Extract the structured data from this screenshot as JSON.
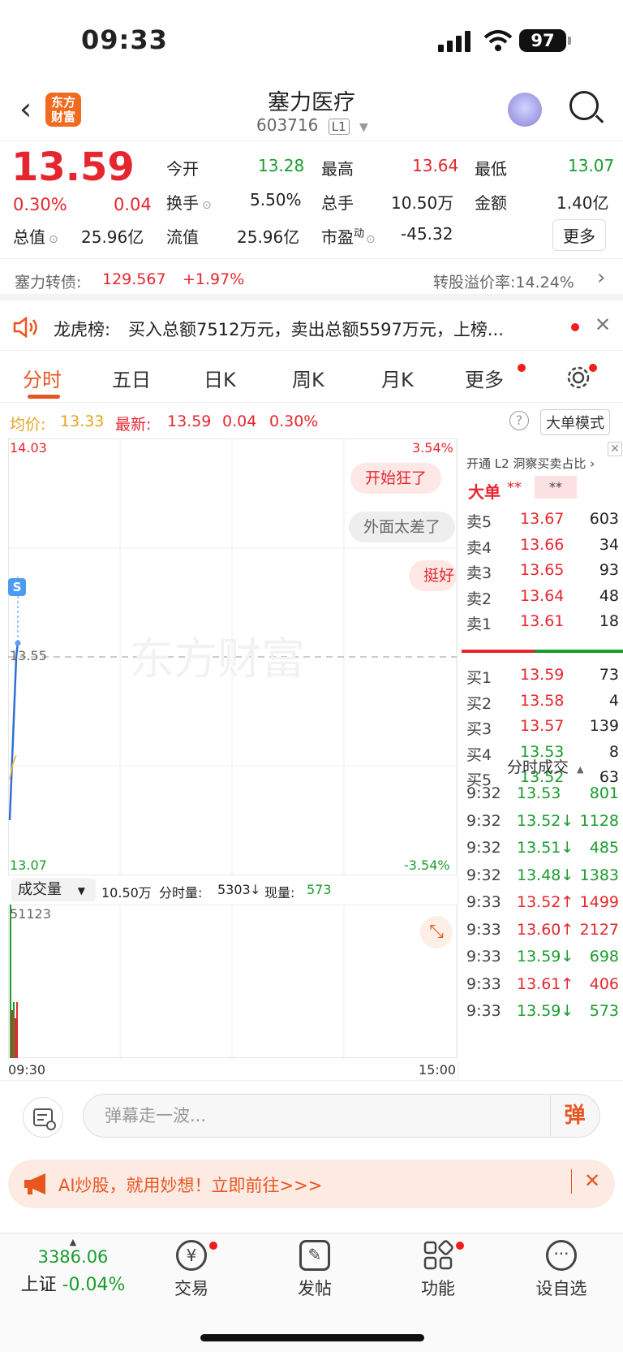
{
  "status": {
    "time": "09:33",
    "battery": "97"
  },
  "header": {
    "name": "塞力医疗",
    "code": "603716",
    "level": "L1",
    "logo": "东方\n财富"
  },
  "quote": {
    "price": "13.59",
    "pct": "0.30%",
    "change": "0.04",
    "open_label": "今开",
    "open": "13.28",
    "high_label": "最高",
    "high": "13.64",
    "low_label": "最低",
    "low": "13.07",
    "turnover_label": "换手",
    "turnover": "5.50%",
    "vol_label": "总手",
    "vol": "10.50万",
    "amt_label": "金额",
    "amt": "1.40亿",
    "mcap_label": "总值",
    "mcap": "25.96亿",
    "float_label": "流值",
    "float": "25.96亿",
    "pe_label": "市盈",
    "pe_sup": "动",
    "pe": "-45.32",
    "more": "更多"
  },
  "bond": {
    "label": "塞力转债:",
    "price": "129.567",
    "pct": "+1.97%",
    "premium": "转股溢价率:14.24%"
  },
  "dragon": {
    "label": "龙虎榜:",
    "text": "买入总额7512万元，卖出总额5597万元，上榜..."
  },
  "tabs": [
    "分时",
    "五日",
    "日K",
    "周K",
    "月K",
    "更多"
  ],
  "avg": {
    "avg_label": "均价:",
    "avg": "13.33",
    "latest_label": "最新:",
    "latest": "13.59",
    "chg": "0.04",
    "pct": "0.30%",
    "big_mode": "大单模式"
  },
  "chart": {
    "top_price": "14.03",
    "top_pct": "3.54%",
    "mid_price": "13.55",
    "bottom_price": "13.07",
    "bottom_pct": "-3.54%",
    "time_start": "09:30",
    "time_end": "15:00",
    "watermark": "东方财富",
    "s_marker": "S",
    "danmu": [
      "开始狂了",
      "外面太差了",
      "挺好"
    ]
  },
  "volume": {
    "selector": "成交量",
    "total": "10.50万",
    "fen_label": "分时量:",
    "fen": "5303",
    "now_label": "现量:",
    "now": "573",
    "max": "51123"
  },
  "book": {
    "l2": "开通 L2 洞察买卖占比",
    "big": "大单",
    "stars1": "**",
    "stars2": "**",
    "asks": [
      {
        "label": "卖5",
        "price": "13.67",
        "vol": "603"
      },
      {
        "label": "卖4",
        "price": "13.66",
        "vol": "34"
      },
      {
        "label": "卖3",
        "price": "13.65",
        "vol": "93"
      },
      {
        "label": "卖2",
        "price": "13.64",
        "vol": "48"
      },
      {
        "label": "卖1",
        "price": "13.61",
        "vol": "18"
      }
    ],
    "bids": [
      {
        "label": "买1",
        "price": "13.59",
        "vol": "73"
      },
      {
        "label": "买2",
        "price": "13.58",
        "vol": "4"
      },
      {
        "label": "买3",
        "price": "13.57",
        "vol": "139"
      },
      {
        "label": "买4",
        "price": "13.53",
        "vol": "8"
      },
      {
        "label": "买5",
        "price": "13.52",
        "vol": "63"
      }
    ],
    "ticks_title": "分时成交",
    "ticks": [
      {
        "time": "9:32",
        "price": "13.53",
        "dir": "",
        "vol": "801",
        "color": "green"
      },
      {
        "time": "9:32",
        "price": "13.52↓",
        "dir": "down",
        "vol": "1128",
        "color": "green"
      },
      {
        "time": "9:32",
        "price": "13.51↓",
        "dir": "down",
        "vol": "485",
        "color": "green"
      },
      {
        "time": "9:32",
        "price": "13.48↓",
        "dir": "down",
        "vol": "1383",
        "color": "green"
      },
      {
        "time": "9:33",
        "price": "13.52↑",
        "dir": "up",
        "vol": "1499",
        "color": "red"
      },
      {
        "time": "9:33",
        "price": "13.60↑",
        "dir": "up",
        "vol": "2127",
        "color": "red"
      },
      {
        "time": "9:33",
        "price": "13.59↓",
        "dir": "down",
        "vol": "698",
        "color": "green"
      },
      {
        "time": "9:33",
        "price": "13.61↑",
        "dir": "up",
        "vol": "406",
        "color": "red"
      },
      {
        "time": "9:33",
        "price": "13.59↓",
        "dir": "down",
        "vol": "573",
        "color": "green"
      }
    ]
  },
  "comment": {
    "placeholder": "弹幕走一波...",
    "btn": "弹"
  },
  "ai": {
    "text": "AI炒股，就用妙想！立即前往>>>"
  },
  "bottom": {
    "index_value": "3386.06",
    "index_name": "上证",
    "index_pct": "-0.04%",
    "items": [
      "交易",
      "发帖",
      "功能",
      "设自选"
    ]
  },
  "colors": {
    "red": "#e6262e",
    "green": "#1a9c2e",
    "accent": "#e8561f"
  }
}
